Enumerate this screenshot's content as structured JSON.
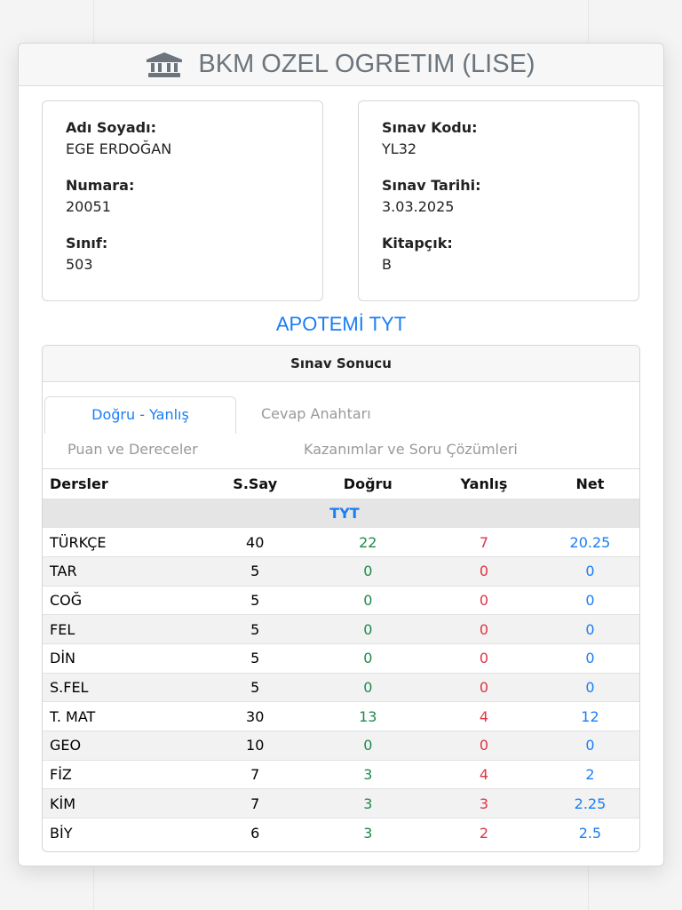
{
  "header": {
    "title": "BKM OZEL OGRETIM (LISE)",
    "icon": "bank-icon"
  },
  "student": [
    {
      "label": "Adı Soyadı:",
      "value": "EGE ERDOĞAN"
    },
    {
      "label": "Numara:",
      "value": "20051"
    },
    {
      "label": "Sınıf:",
      "value": "503"
    }
  ],
  "exam": [
    {
      "label": "Sınav Kodu:",
      "value": "YL32"
    },
    {
      "label": "Sınav Tarihi:",
      "value": "3.03.2025"
    },
    {
      "label": "Kitapçık:",
      "value": "B"
    }
  ],
  "exam_title": "APOTEMİ TYT",
  "results": {
    "title": "Sınav Sonucu",
    "tabs": [
      "Doğru - Yanlış",
      "Cevap Anahtarı",
      "Puan ve Dereceler",
      "Kazanımlar ve Soru Çözümleri"
    ],
    "columns": [
      "Dersler",
      "S.Say",
      "Doğru",
      "Yanlış",
      "Net"
    ],
    "group": "TYT",
    "rows": [
      [
        "TÜRKÇE",
        "40",
        "22",
        "7",
        "20.25"
      ],
      [
        "TAR",
        "5",
        "0",
        "0",
        "0"
      ],
      [
        "COĞ",
        "5",
        "0",
        "0",
        "0"
      ],
      [
        "FEL",
        "5",
        "0",
        "0",
        "0"
      ],
      [
        "DİN",
        "5",
        "0",
        "0",
        "0"
      ],
      [
        "S.FEL",
        "5",
        "0",
        "0",
        "0"
      ],
      [
        "T. MAT",
        "30",
        "13",
        "4",
        "12"
      ],
      [
        "GEO",
        "10",
        "0",
        "0",
        "0"
      ],
      [
        "FİZ",
        "7",
        "3",
        "4",
        "2"
      ],
      [
        "KİM",
        "7",
        "3",
        "3",
        "2.25"
      ],
      [
        "BİY",
        "6",
        "3",
        "2",
        "2.5"
      ]
    ]
  }
}
